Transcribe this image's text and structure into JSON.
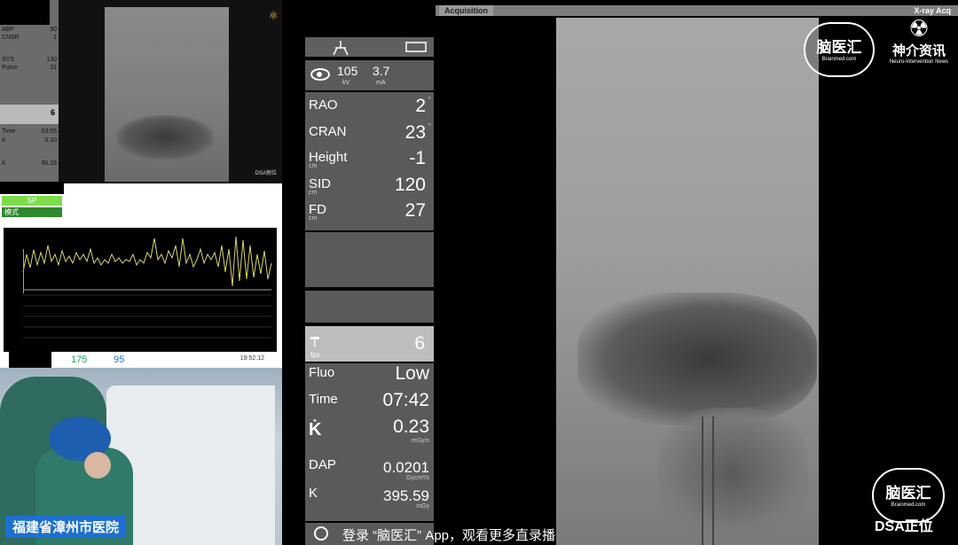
{
  "mini_monitor": {
    "vitals": [
      {
        "label": "ABP",
        "value": "90"
      },
      {
        "label": "CNSR",
        "value": "1"
      },
      {
        "label": "SYS",
        "value": "130"
      },
      {
        "label": "Pulse",
        "value": "31"
      }
    ],
    "fps": "6",
    "lower": [
      {
        "label": "Time",
        "value": "03:55"
      },
      {
        "label": "K",
        "value": "0.10"
      },
      {
        "label": "K",
        "value": "96.16"
      }
    ]
  },
  "mini_xray": {
    "dsa_label": "DSA侧位",
    "logo": "⚛"
  },
  "wave_monitor": {
    "sp_label": "SP",
    "mode_label": "模式",
    "hr": "175",
    "spo2": "95",
    "time": "19:52:12"
  },
  "camera": {
    "caption": "福建省漳州市医院"
  },
  "control": {
    "kv_value": "105",
    "kv_unit": "kV",
    "ma_value": "3.7",
    "ma_unit": "mA",
    "geometry": [
      {
        "label": "RAO",
        "value": "2",
        "unit": "",
        "deg": "°"
      },
      {
        "label": "CRAN",
        "value": "23",
        "unit": "",
        "deg": "°"
      },
      {
        "label": "Height",
        "value": "-1",
        "unit": "cm",
        "deg": ""
      },
      {
        "label": "SID",
        "value": "120",
        "unit": "cm",
        "deg": ""
      },
      {
        "label": "FD",
        "value": "27",
        "unit": "cm",
        "deg": ""
      }
    ],
    "fps_value": "6",
    "fps_unit": "fps",
    "fluo": [
      {
        "label": "Fluo",
        "value": "Low",
        "unit": ""
      },
      {
        "label": "Time",
        "value": "07:42",
        "unit": ""
      },
      {
        "label": "K̇",
        "value": "0.23",
        "unit": "mGy/s"
      },
      {
        "label": "DAP",
        "value": "0.0201",
        "unit": "Gycm²/s"
      },
      {
        "label": "K",
        "value": "395.59",
        "unit": "mGy"
      }
    ]
  },
  "main_xray": {
    "tab_label": "Acquisition",
    "mode_label": "X-ray Acq"
  },
  "brands": {
    "brand1_text": "脑医汇",
    "brand1_sub": "Brainmed.com",
    "brand2_text": "神介资讯",
    "brand2_sub": "Neuro-Intervention News",
    "brand3_text": "脑医汇",
    "brand3_sub": "Brainmed.com",
    "view_label": "DSA正位"
  },
  "promo": "登录 “脑医汇” App，观看更多直录播"
}
